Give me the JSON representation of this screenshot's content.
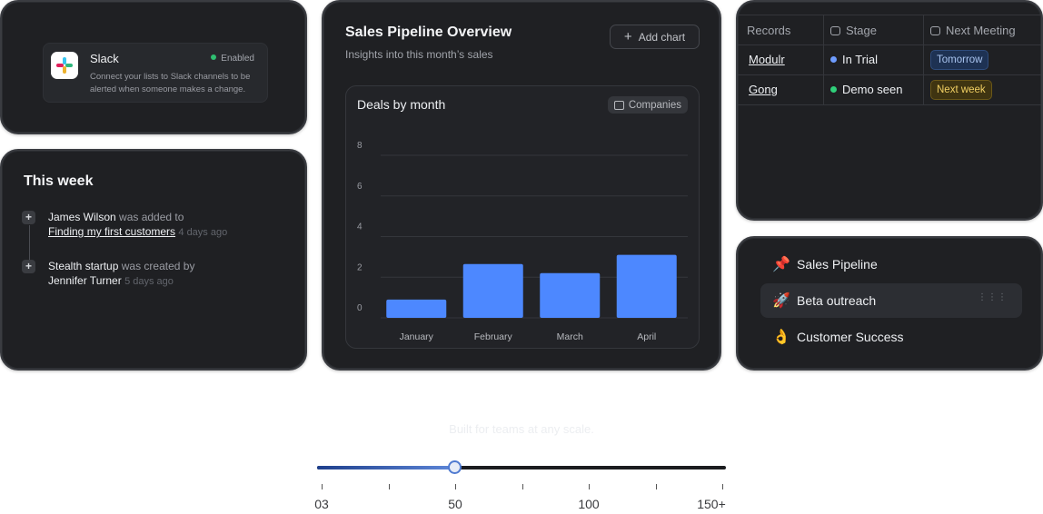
{
  "slack": {
    "name": "Slack",
    "status": "Enabled",
    "description": "Connect your lists to Slack channels to be alerted when someone makes a change.",
    "status_color": "#2fbf71"
  },
  "this_week": {
    "title": "This week",
    "items": [
      {
        "subject": "James Wilson",
        "action": "was added to",
        "object": "Finding my first customers",
        "time": "4 days ago"
      },
      {
        "subject": "Stealth startup",
        "action": "was created by",
        "object": "Jennifer Turner",
        "time": "5 days ago"
      }
    ]
  },
  "chart_card": {
    "title": "Sales Pipeline Overview",
    "subtitle": "Insights into this month’s sales",
    "add_button": "Add chart",
    "inner_title": "Deals by month",
    "filter_chip": "Companies"
  },
  "chart_data": {
    "type": "bar",
    "title": "Deals by month",
    "categories": [
      "January",
      "February",
      "March",
      "April"
    ],
    "values": [
      0.9,
      2.65,
      2.2,
      3.1
    ],
    "yticks": [
      0,
      2,
      4,
      6,
      8
    ],
    "ylim": [
      0,
      8
    ],
    "xlabel": "",
    "ylabel": "",
    "grid": true,
    "bar_color": "#4d88ff"
  },
  "records": {
    "columns": [
      "Records",
      "Stage",
      "Next Meeting"
    ],
    "rows": [
      {
        "record": "Modulr",
        "stage": "In Trial",
        "stage_color": "#6e9cff",
        "meeting": "Tomorrow"
      },
      {
        "record": "Gong",
        "stage": "Demo seen",
        "stage_color": "#2fd07a",
        "meeting": "Next week"
      }
    ]
  },
  "lists": {
    "items": [
      {
        "emoji": "📌",
        "label": "Sales Pipeline",
        "icon": "pushpin-icon"
      },
      {
        "emoji": "🚀",
        "label": "Beta outreach",
        "icon": "rocket-icon"
      },
      {
        "emoji": "👌",
        "label": "Customer Success",
        "icon": "ok-hand-icon"
      }
    ],
    "active_index": 1
  },
  "footer": {
    "tagline": "Built for teams at any scale.",
    "slider": {
      "value_fraction": 0.338,
      "tick_labels": [
        "03",
        "50",
        "100",
        "150+"
      ]
    }
  }
}
